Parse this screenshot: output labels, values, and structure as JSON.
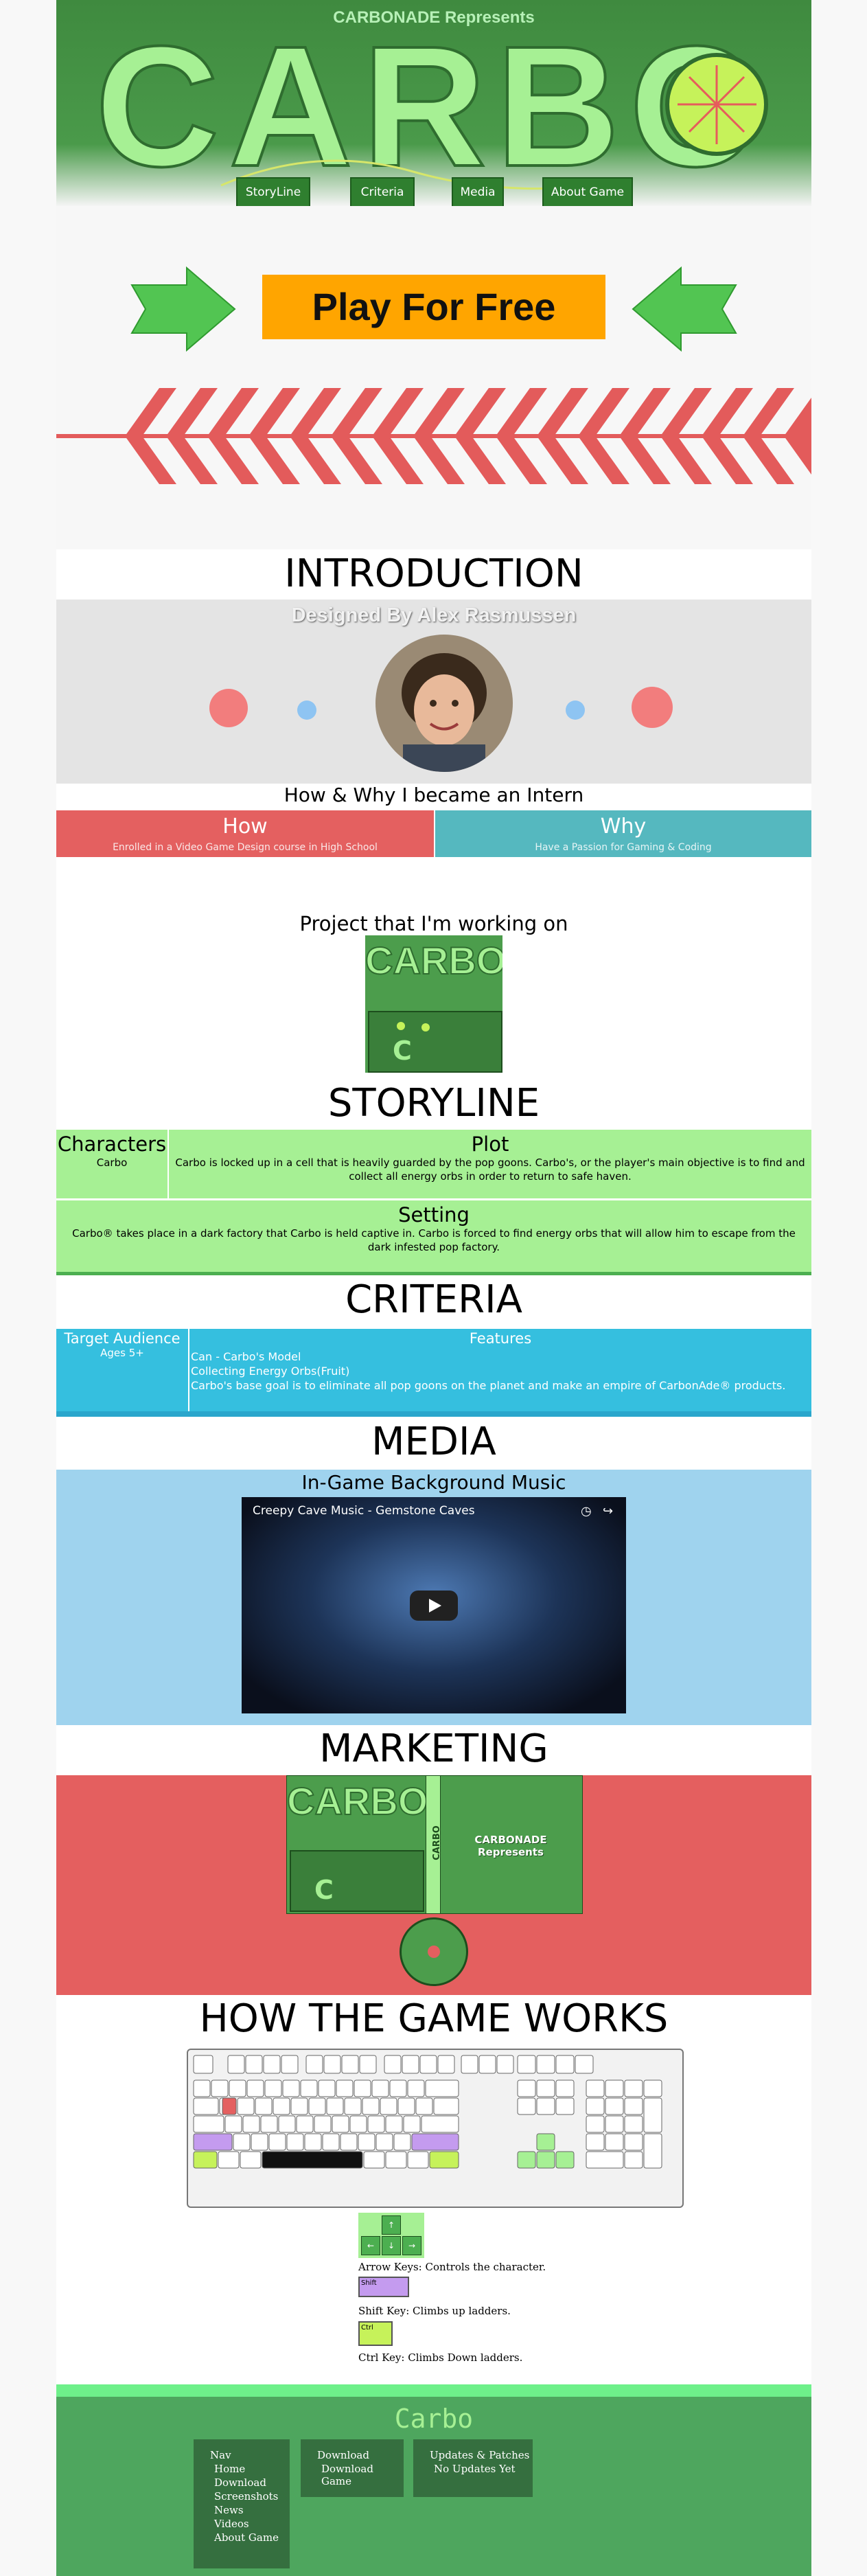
{
  "header": {
    "presents": "CARBONADE Represents",
    "title": "CARBO",
    "nav": [
      "StoryLine",
      "Criteria",
      "Media",
      "About Game"
    ]
  },
  "play": {
    "label": "Play For Free"
  },
  "intro": {
    "heading": "INTRODUCTION",
    "designed_by": "Designed By Alex Rasmussen",
    "how_heading": "How & Why I became an Intern",
    "how": {
      "title": "How",
      "text": "Enrolled in a Video Game Design course in High School"
    },
    "why": {
      "title": "Why",
      "text": "Have a Passion for Gaming & Coding"
    },
    "project_heading": "Project that I'm working on",
    "cover": {
      "title": "CARBO",
      "letter": "C"
    }
  },
  "storyline": {
    "heading": "STORYLINE",
    "characters": {
      "title": "Characters",
      "text": "Carbo"
    },
    "plot": {
      "title": "Plot",
      "text": "Carbo is locked up in a cell that is heavily guarded by the pop goons. Carbo's, or the player's main objective is to find and collect all energy orbs in order to return to safe haven."
    },
    "setting": {
      "title": "Setting",
      "text": "Carbo® takes place in a dark factory that Carbo is held captive in. Carbo is forced to find energy orbs that will allow him to escape from the dark infested pop factory."
    }
  },
  "criteria": {
    "heading": "CRITERIA",
    "audience": {
      "title": "Target Audience",
      "text": "Ages 5+"
    },
    "features": {
      "title": "Features",
      "items": [
        "Can - Carbo's Model",
        "Collecting Energy Orbs(Fruit)",
        "Carbo's base goal is to eliminate all pop goons on the planet and make an empire of CarbonAde® products."
      ]
    }
  },
  "media": {
    "heading": "MEDIA",
    "subheading": "In-Game Background Music",
    "video_title": "Creepy Cave Music - Gemstone Caves"
  },
  "marketing": {
    "heading": "MARKETING",
    "side_text": "CARBO",
    "back_text": "CARBONADE Represents"
  },
  "game": {
    "heading": "HOW THE GAME WORKS",
    "legend": [
      "Arrow Keys: Controls the character.",
      "Shift Key: Climbs up ladders.",
      "Ctrl Key: Climbs Down ladders."
    ],
    "shift_key": "Shift",
    "ctrl_key": "Ctrl"
  },
  "footer": {
    "title": "Carbo",
    "nav_title": "Nav",
    "nav_items": [
      "Home",
      "Download",
      "Screenshots",
      "News",
      "Videos",
      "About Game"
    ],
    "download_title": "Download",
    "download_item": "Download Game",
    "updates_title": "Updates & Patches",
    "updates_item": "No Updates Yet"
  },
  "colors": {
    "header_green": "#4a9a4a",
    "title_green": "#a6f094",
    "play_orange": "#ffa500",
    "how_red": "#e46060",
    "why_teal": "#55b8bf",
    "criteria_blue": "#35bfdf",
    "media_blue": "#9fd3ee",
    "marketing_red": "#e45f5f",
    "footer_green": "#4ea65e"
  }
}
